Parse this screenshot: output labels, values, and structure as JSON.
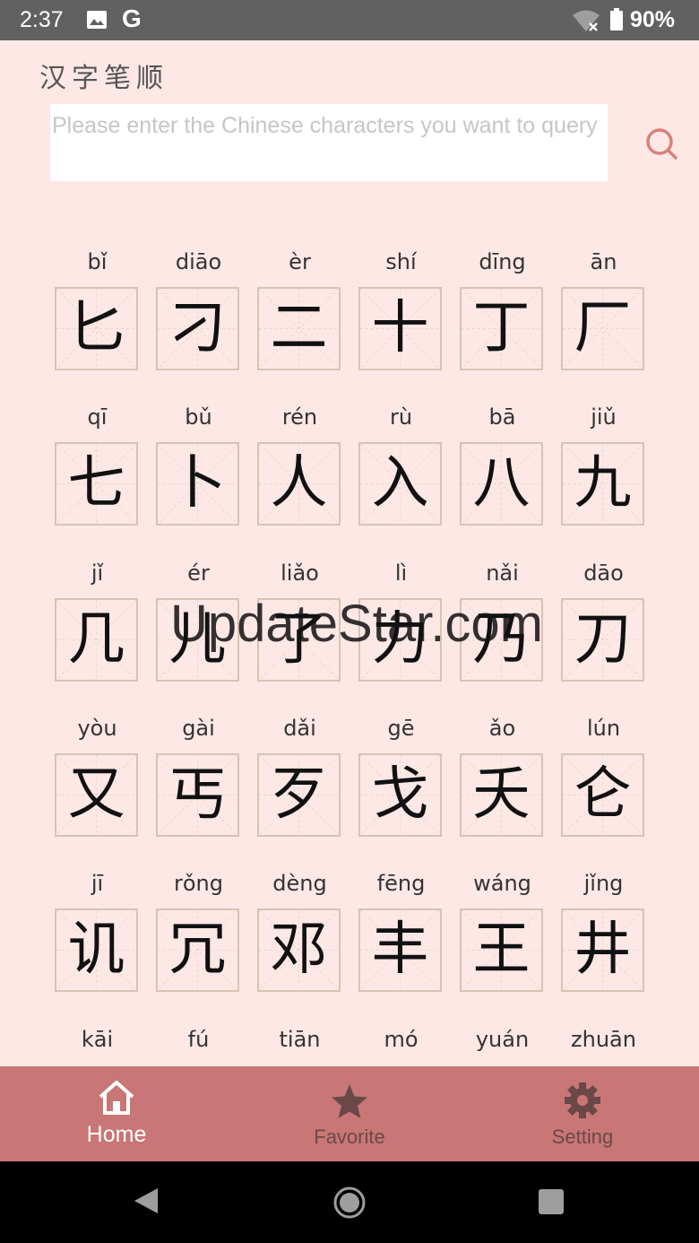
{
  "status_bar": {
    "time": "2:37",
    "g_label": "G",
    "battery": "90%"
  },
  "app": {
    "title": "汉字笔顺"
  },
  "search": {
    "placeholder": "Please enter the Chinese characters you want to query"
  },
  "characters": [
    {
      "pinyin": "bǐ",
      "hanzi": "匕"
    },
    {
      "pinyin": "diāo",
      "hanzi": "刁"
    },
    {
      "pinyin": "èr",
      "hanzi": "二"
    },
    {
      "pinyin": "shí",
      "hanzi": "十"
    },
    {
      "pinyin": "dīng",
      "hanzi": "丁"
    },
    {
      "pinyin": "ān",
      "hanzi": "厂"
    },
    {
      "pinyin": "qī",
      "hanzi": "七"
    },
    {
      "pinyin": "bǔ",
      "hanzi": "卜"
    },
    {
      "pinyin": "rén",
      "hanzi": "人"
    },
    {
      "pinyin": "rù",
      "hanzi": "入"
    },
    {
      "pinyin": "bā",
      "hanzi": "八"
    },
    {
      "pinyin": "jiǔ",
      "hanzi": "九"
    },
    {
      "pinyin": "jǐ",
      "hanzi": "几"
    },
    {
      "pinyin": "ér",
      "hanzi": "儿"
    },
    {
      "pinyin": "liǎo",
      "hanzi": "了"
    },
    {
      "pinyin": "lì",
      "hanzi": "力"
    },
    {
      "pinyin": "nǎi",
      "hanzi": "乃"
    },
    {
      "pinyin": "dāo",
      "hanzi": "刀"
    },
    {
      "pinyin": "yòu",
      "hanzi": "又"
    },
    {
      "pinyin": "gài",
      "hanzi": "丐"
    },
    {
      "pinyin": "dǎi",
      "hanzi": "歹"
    },
    {
      "pinyin": "gē",
      "hanzi": "戈"
    },
    {
      "pinyin": "ǎo",
      "hanzi": "夭"
    },
    {
      "pinyin": "lún",
      "hanzi": "仑"
    },
    {
      "pinyin": "jī",
      "hanzi": "讥"
    },
    {
      "pinyin": "rǒng",
      "hanzi": "冗"
    },
    {
      "pinyin": "dèng",
      "hanzi": "邓"
    },
    {
      "pinyin": "fēng",
      "hanzi": "丰"
    },
    {
      "pinyin": "wáng",
      "hanzi": "王"
    },
    {
      "pinyin": "jǐng",
      "hanzi": "井"
    },
    {
      "pinyin": "kāi",
      "hanzi": ""
    },
    {
      "pinyin": "fú",
      "hanzi": ""
    },
    {
      "pinyin": "tiān",
      "hanzi": ""
    },
    {
      "pinyin": "mó",
      "hanzi": ""
    },
    {
      "pinyin": "yuán",
      "hanzi": ""
    },
    {
      "pinyin": "zhuān",
      "hanzi": ""
    }
  ],
  "bottom_nav": {
    "home": "Home",
    "favorite": "Favorite",
    "setting": "Setting"
  },
  "watermark": "UpdateStar.com",
  "colors": {
    "background": "#fde8e6",
    "nav_bar": "#c97676",
    "accent": "#d9807a"
  }
}
